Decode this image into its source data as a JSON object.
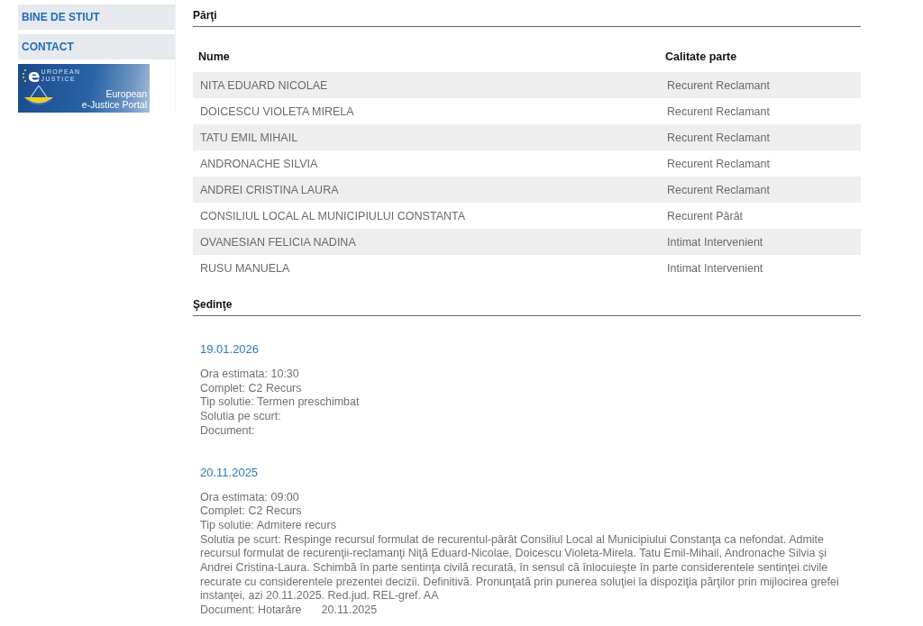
{
  "sidebar": {
    "items": [
      {
        "label": "BINE DE STIUT"
      },
      {
        "label": "CONTACT"
      }
    ],
    "banner": {
      "mark": "e",
      "top": "UROPEAN",
      "bottom": "JUSTICE",
      "caption": [
        "European",
        "e-Justice Portal"
      ]
    }
  },
  "parties": {
    "title": "Părţi",
    "columns": [
      "Nume",
      "Calitate parte"
    ],
    "rows": [
      {
        "name": "NITA EDUARD NICOLAE",
        "role": "Recurent Reclamant"
      },
      {
        "name": "DOICESCU VIOLETA MIRELA",
        "role": "Recurent Reclamant"
      },
      {
        "name": "TATU EMIL MIHAIL",
        "role": "Recurent Reclamant"
      },
      {
        "name": "ANDRONACHE SILVIA",
        "role": "Recurent Reclamant"
      },
      {
        "name": "ANDREI CRISTINA LAURA",
        "role": "Recurent Reclamant"
      },
      {
        "name": "CONSILIUL LOCAL AL MUNICIPIULUI CONSTANTA",
        "role": "Recurent Pârât"
      },
      {
        "name": "OVANESIAN FELICIA NADINA",
        "role": "Intimat Intervenient"
      },
      {
        "name": "RUSU MANUELA",
        "role": "Intimat Intervenient"
      }
    ]
  },
  "sessions": {
    "title": "Şedinţe",
    "items": [
      {
        "date": "19.01.2026",
        "lines": [
          {
            "text": "Ora estimata: 10:30"
          },
          {
            "text": "Complet: C2 Recurs"
          },
          {
            "text": "Tip solutie: Termen preschimbat"
          },
          {
            "text": "Solutia pe scurt:"
          },
          {
            "text": "Document:"
          }
        ]
      },
      {
        "date": "20.11.2025",
        "lines": [
          {
            "text": "Ora estimata: 09:00"
          },
          {
            "text": "Complet: C2 Recurs"
          },
          {
            "text": "Tip solutie: Admitere recurs"
          },
          {
            "text": "Solutia pe scurt: Respinge recursul formulat de recurentul-pârât Consiliul Local al Municipiului Constanţa ca nefondat. Admite recursul formulat de recurenţii-reclamanţi Niţă Eduard-Nicolae, Doicescu Violeta-Mirela. Tatu Emil-Mihail, Andronache Silvia şi Andrei Cristina-Laura. Schimbă în parte sentinţa civilă recurată, în sensul că înlocuieşte în parte considerentele sentinţei civile recurate cu considerentele prezentei decizii. Definitivă. Pronunţată prin punerea soluţiei la dispoziţia părţilor prin mijlocirea grefei instanţei, azi 20.11.2025. Red.jud. REL-gref. AA"
          },
          {
            "text": "Document: Hotarâre",
            "date": "20.11.2025"
          }
        ]
      }
    ]
  }
}
